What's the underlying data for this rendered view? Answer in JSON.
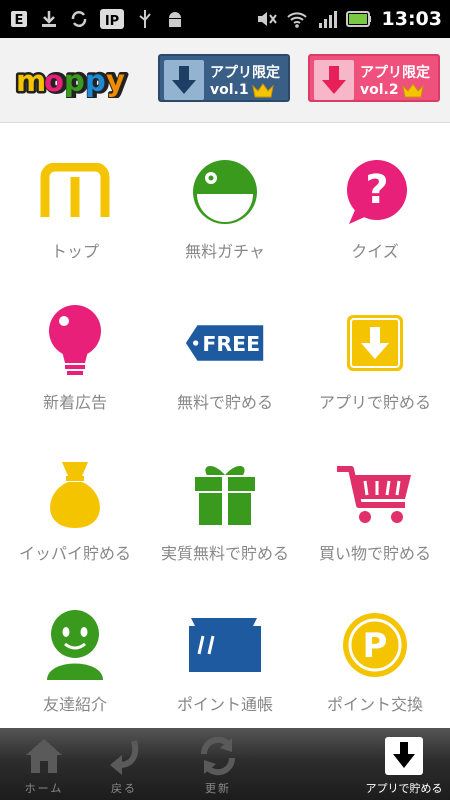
{
  "statusbar": {
    "time": "13:03"
  },
  "header": {
    "logo_text": "moppy",
    "banner1": {
      "line1": "アプリ限定",
      "line2": "vol.1"
    },
    "banner2": {
      "line1": "アプリ限定",
      "line2": "vol.2"
    }
  },
  "menu": [
    {
      "label": "トップ",
      "icon": "moppy-m-icon"
    },
    {
      "label": "無料ガチャ",
      "icon": "gacha-icon"
    },
    {
      "label": "クイズ",
      "icon": "quiz-icon"
    },
    {
      "label": "新着広告",
      "icon": "lightbulb-icon"
    },
    {
      "label": "無料で貯める",
      "icon": "free-tag-icon"
    },
    {
      "label": "アプリで貯める",
      "icon": "app-download-icon"
    },
    {
      "label": "イッパイ貯める",
      "icon": "money-bag-icon"
    },
    {
      "label": "実質無料で貯める",
      "icon": "gift-box-icon"
    },
    {
      "label": "買い物で貯める",
      "icon": "shopping-cart-icon"
    },
    {
      "label": "友達紹介",
      "icon": "friend-icon"
    },
    {
      "label": "ポイント通帳",
      "icon": "passbook-icon"
    },
    {
      "label": "ポイント交換",
      "icon": "point-coin-icon"
    }
  ],
  "free_tag_text": "FREE",
  "coin_letter": "P",
  "bottombar": {
    "home": "ホーム",
    "back": "戻る",
    "refresh": "更新",
    "app": "アプリで貯める"
  },
  "colors": {
    "yellow": "#f5c400",
    "green": "#3a9a1e",
    "pink": "#e8207a",
    "blue": "#1e5aa0",
    "cart": "#e0306a"
  }
}
